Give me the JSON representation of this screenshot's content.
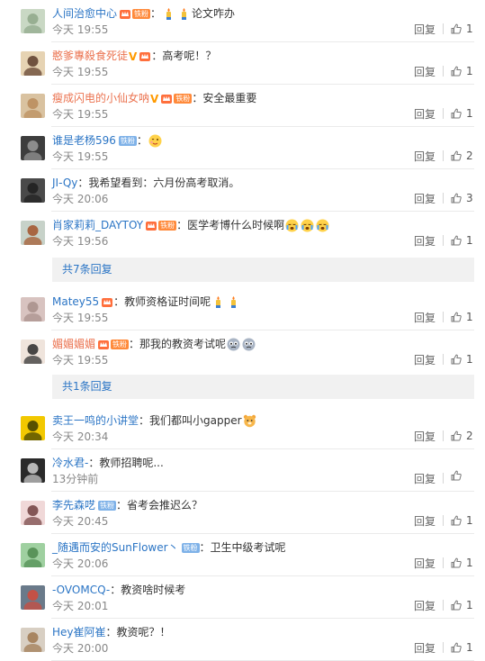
{
  "colors": {
    "username": "#eb7350",
    "username_alt": "#2b75c5",
    "link": "#2b75c5",
    "time": "#888888",
    "more_bg": "#f1f1f1"
  },
  "reply_label": "回复",
  "comments": [
    {
      "user": "人间治愈中心",
      "badges": [
        "crown-iron"
      ],
      "text": "：",
      "emojis": [
        "candle-emoji",
        "candle-emoji"
      ],
      "text2": "论文咋办",
      "time": "今天 19:55",
      "likes": "1"
    },
    {
      "user": "憨爹專殺食死徒",
      "badges": [
        "v",
        "crown"
      ],
      "text": "：高考呢！？",
      "time": "今天 19:55",
      "likes": "1"
    },
    {
      "user": "瘦成闪电的小仙女呐",
      "badges": [
        "v",
        "crown-iron"
      ],
      "text": "：安全最重要",
      "time": "今天 19:55",
      "likes": "1"
    },
    {
      "user": "谁是老杨596",
      "badges": [
        "iron-blue"
      ],
      "text": "：",
      "emojis": [
        "wink-emoji"
      ],
      "time": "今天 19:55",
      "likes": "2"
    },
    {
      "user": "JI-Qy",
      "badges": [],
      "text": "：我希望看到：六月份高考取消。",
      "time": "今天 20:06",
      "likes": "3"
    },
    {
      "user": "肖家莉莉_DAYTOY",
      "badges": [
        "crown-iron"
      ],
      "text": "：医学考博什么时候啊",
      "emojis": [
        "cry-emoji",
        "cry-emoji",
        "cry-emoji"
      ],
      "time": "今天 19:56",
      "likes": "1"
    },
    {
      "user": "Matey55",
      "badges": [
        "crown"
      ],
      "text": "：教师资格证时间呢",
      "emojis": [
        "candle-emoji",
        "candle-emoji"
      ],
      "time": "今天 19:55",
      "likes": "1"
    },
    {
      "user": "媚媚媚媚",
      "badges": [
        "crown-iron"
      ],
      "text": "：那我的教资考试呢",
      "emojis": [
        "sob-emoji",
        "sob-emoji"
      ],
      "time": "今天 19:55",
      "likes": "1"
    },
    {
      "user": "卖王一鸣的小讲堂",
      "badges": [],
      "text": "：我们都叫小gapper",
      "emojis": [
        "bear-emoji"
      ],
      "time": "今天 20:34",
      "likes": "2"
    },
    {
      "user": "冷水君-",
      "badges": [],
      "text": "：教师招聘呢...",
      "time": "13分钟前",
      "likes": ""
    },
    {
      "user": "李先森呓",
      "badges": [
        "iron-blue"
      ],
      "text": "：省考会推迟么？",
      "time": "今天 20:45",
      "likes": "1"
    },
    {
      "user": "_随遇而安的SunFlower丶",
      "badges": [
        "iron-blue"
      ],
      "text": "：卫生中级考试呢",
      "time": "今天 20:06",
      "likes": "1"
    },
    {
      "user": "-OVOMCQ-",
      "badges": [],
      "text": "：教资啥时候考",
      "time": "今天 20:01",
      "likes": "1"
    },
    {
      "user": "Hey崔阿崔",
      "badges": [],
      "text": "：教资呢？！",
      "time": "今天 20:00",
      "likes": "1"
    }
  ],
  "more_replies": [
    {
      "label": "共7条回复"
    },
    {
      "label": "共1条回复"
    }
  ],
  "badge_labels": {
    "iron": "铁粉",
    "v": "V"
  }
}
